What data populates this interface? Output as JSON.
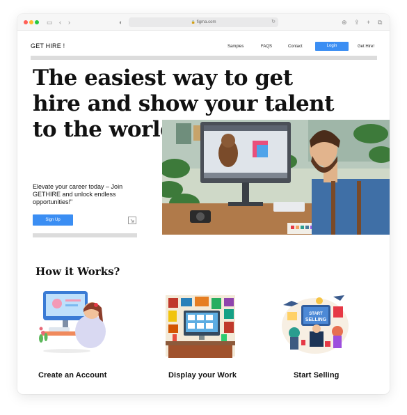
{
  "browser": {
    "url": "figma.com"
  },
  "nav": {
    "brand": "GET HIRE !",
    "links": [
      "Samples",
      "FAQS",
      "Contact"
    ],
    "login_label": "Login",
    "cta_label": "Get Hire!"
  },
  "hero": {
    "title": "The easiest way to get hire and show your talent to the world",
    "tagline": "Elevate your career today – Join GETHIRE and unlock endless opportunities!\"",
    "signup_label": "Sign Up"
  },
  "how": {
    "title": "How it Works?",
    "steps": [
      {
        "label": "Create an Account"
      },
      {
        "label": "Display your Work"
      },
      {
        "label": "Start Selling"
      }
    ],
    "selling_sign": "START SELLING"
  },
  "colors": {
    "accent": "#3b8ef3",
    "divider": "#dcdcdc"
  }
}
